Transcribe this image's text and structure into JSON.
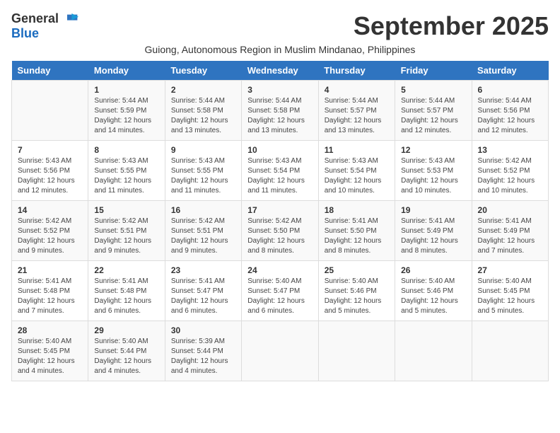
{
  "logo": {
    "general": "General",
    "blue": "Blue"
  },
  "title": "September 2025",
  "subtitle": "Guiong, Autonomous Region in Muslim Mindanao, Philippines",
  "days_of_week": [
    "Sunday",
    "Monday",
    "Tuesday",
    "Wednesday",
    "Thursday",
    "Friday",
    "Saturday"
  ],
  "weeks": [
    [
      {
        "day": "",
        "info": ""
      },
      {
        "day": "1",
        "info": "Sunrise: 5:44 AM\nSunset: 5:59 PM\nDaylight: 12 hours\nand 14 minutes."
      },
      {
        "day": "2",
        "info": "Sunrise: 5:44 AM\nSunset: 5:58 PM\nDaylight: 12 hours\nand 13 minutes."
      },
      {
        "day": "3",
        "info": "Sunrise: 5:44 AM\nSunset: 5:58 PM\nDaylight: 12 hours\nand 13 minutes."
      },
      {
        "day": "4",
        "info": "Sunrise: 5:44 AM\nSunset: 5:57 PM\nDaylight: 12 hours\nand 13 minutes."
      },
      {
        "day": "5",
        "info": "Sunrise: 5:44 AM\nSunset: 5:57 PM\nDaylight: 12 hours\nand 12 minutes."
      },
      {
        "day": "6",
        "info": "Sunrise: 5:44 AM\nSunset: 5:56 PM\nDaylight: 12 hours\nand 12 minutes."
      }
    ],
    [
      {
        "day": "7",
        "info": "Sunrise: 5:43 AM\nSunset: 5:56 PM\nDaylight: 12 hours\nand 12 minutes."
      },
      {
        "day": "8",
        "info": "Sunrise: 5:43 AM\nSunset: 5:55 PM\nDaylight: 12 hours\nand 11 minutes."
      },
      {
        "day": "9",
        "info": "Sunrise: 5:43 AM\nSunset: 5:55 PM\nDaylight: 12 hours\nand 11 minutes."
      },
      {
        "day": "10",
        "info": "Sunrise: 5:43 AM\nSunset: 5:54 PM\nDaylight: 12 hours\nand 11 minutes."
      },
      {
        "day": "11",
        "info": "Sunrise: 5:43 AM\nSunset: 5:54 PM\nDaylight: 12 hours\nand 10 minutes."
      },
      {
        "day": "12",
        "info": "Sunrise: 5:43 AM\nSunset: 5:53 PM\nDaylight: 12 hours\nand 10 minutes."
      },
      {
        "day": "13",
        "info": "Sunrise: 5:42 AM\nSunset: 5:52 PM\nDaylight: 12 hours\nand 10 minutes."
      }
    ],
    [
      {
        "day": "14",
        "info": "Sunrise: 5:42 AM\nSunset: 5:52 PM\nDaylight: 12 hours\nand 9 minutes."
      },
      {
        "day": "15",
        "info": "Sunrise: 5:42 AM\nSunset: 5:51 PM\nDaylight: 12 hours\nand 9 minutes."
      },
      {
        "day": "16",
        "info": "Sunrise: 5:42 AM\nSunset: 5:51 PM\nDaylight: 12 hours\nand 9 minutes."
      },
      {
        "day": "17",
        "info": "Sunrise: 5:42 AM\nSunset: 5:50 PM\nDaylight: 12 hours\nand 8 minutes."
      },
      {
        "day": "18",
        "info": "Sunrise: 5:41 AM\nSunset: 5:50 PM\nDaylight: 12 hours\nand 8 minutes."
      },
      {
        "day": "19",
        "info": "Sunrise: 5:41 AM\nSunset: 5:49 PM\nDaylight: 12 hours\nand 8 minutes."
      },
      {
        "day": "20",
        "info": "Sunrise: 5:41 AM\nSunset: 5:49 PM\nDaylight: 12 hours\nand 7 minutes."
      }
    ],
    [
      {
        "day": "21",
        "info": "Sunrise: 5:41 AM\nSunset: 5:48 PM\nDaylight: 12 hours\nand 7 minutes."
      },
      {
        "day": "22",
        "info": "Sunrise: 5:41 AM\nSunset: 5:48 PM\nDaylight: 12 hours\nand 6 minutes."
      },
      {
        "day": "23",
        "info": "Sunrise: 5:41 AM\nSunset: 5:47 PM\nDaylight: 12 hours\nand 6 minutes."
      },
      {
        "day": "24",
        "info": "Sunrise: 5:40 AM\nSunset: 5:47 PM\nDaylight: 12 hours\nand 6 minutes."
      },
      {
        "day": "25",
        "info": "Sunrise: 5:40 AM\nSunset: 5:46 PM\nDaylight: 12 hours\nand 5 minutes."
      },
      {
        "day": "26",
        "info": "Sunrise: 5:40 AM\nSunset: 5:46 PM\nDaylight: 12 hours\nand 5 minutes."
      },
      {
        "day": "27",
        "info": "Sunrise: 5:40 AM\nSunset: 5:45 PM\nDaylight: 12 hours\nand 5 minutes."
      }
    ],
    [
      {
        "day": "28",
        "info": "Sunrise: 5:40 AM\nSunset: 5:45 PM\nDaylight: 12 hours\nand 4 minutes."
      },
      {
        "day": "29",
        "info": "Sunrise: 5:40 AM\nSunset: 5:44 PM\nDaylight: 12 hours\nand 4 minutes."
      },
      {
        "day": "30",
        "info": "Sunrise: 5:39 AM\nSunset: 5:44 PM\nDaylight: 12 hours\nand 4 minutes."
      },
      {
        "day": "",
        "info": ""
      },
      {
        "day": "",
        "info": ""
      },
      {
        "day": "",
        "info": ""
      },
      {
        "day": "",
        "info": ""
      }
    ]
  ]
}
